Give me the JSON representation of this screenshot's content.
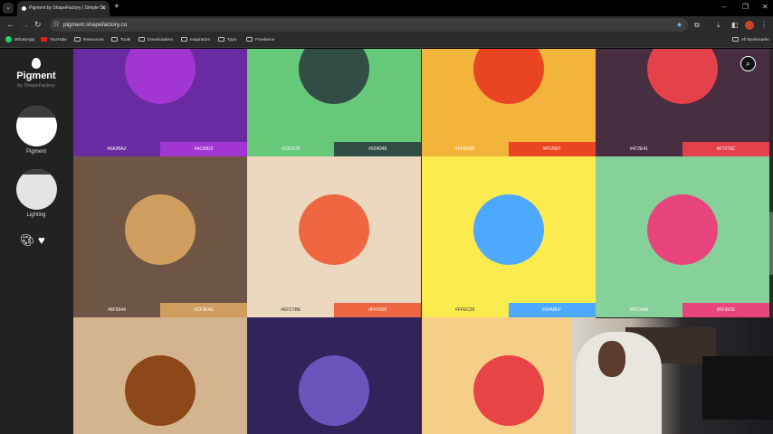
{
  "browser": {
    "tab_title": "Pigment by ShapeFactory | Simple Co",
    "url": "pigment.shapefactory.co",
    "bookmarks": [
      "WhatsApp",
      "YouTube",
      "Resources",
      "Tools",
      "Downloaders",
      "Inspiration",
      "Typo",
      "Freelance"
    ],
    "all_bookmarks": "All Bookmarks"
  },
  "sidebar": {
    "logo": "Pigment",
    "byline": "by ShapeFactory",
    "pigment_label": "Pigment",
    "lighting_label": "Lighting"
  },
  "tiles": [
    {
      "bg": "#6A2BA2",
      "circle": "#A136D2",
      "left": "#6A2BA2",
      "right": "#A136D2"
    },
    {
      "bg": "#66C97A",
      "circle": "#324D46",
      "left": "#23C076",
      "right": "#324D46"
    },
    {
      "bg": "#F2B43A",
      "circle": "#EA4522",
      "left": "#FFB00B",
      "right": "#FF2807"
    },
    {
      "bg": "#472E41",
      "circle": "#E5414A",
      "left": "#472E41",
      "right": "#F7273C"
    },
    {
      "bg": "#6F5644",
      "circle": "#CF9E5E",
      "left": "#6F5644",
      "right": "#CF9E4E"
    },
    {
      "bg": "#EBD8BE",
      "circle": "#EE6640",
      "left": "#EFD7BE",
      "right": "#FF5435",
      "leftDark": true
    },
    {
      "bg": "#FBEB4E",
      "circle": "#4DA8FF",
      "left": "#FFEC26",
      "right": "#0FABFF",
      "leftDark": true
    },
    {
      "bg": "#86D199",
      "circle": "#E8457E",
      "left": "#6FD499",
      "right": "#FF397E"
    },
    {
      "bg": "#D4B48E",
      "circle": "#8E4719"
    },
    {
      "bg": "#30245A",
      "circle": "#6A55BC"
    },
    {
      "bg": "#F5CF88",
      "circle": "#E84446"
    }
  ]
}
